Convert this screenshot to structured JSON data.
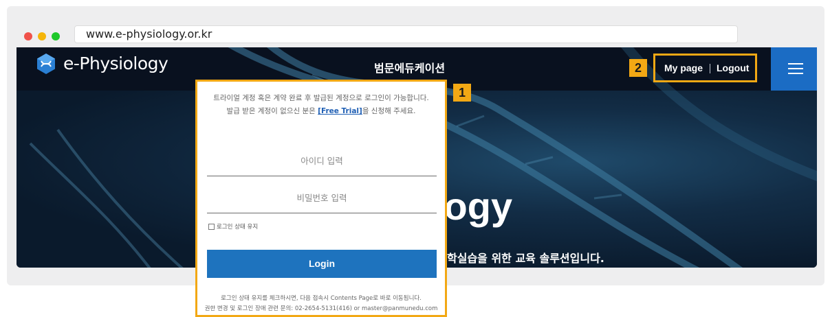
{
  "browser": {
    "url": "www.e-physiology.or.kr"
  },
  "header": {
    "logo_text": "e-Physiology",
    "title": "범문에듀케이션",
    "my_page": "My page",
    "logout": "Logout"
  },
  "hero": {
    "title": "logy",
    "subtitle": "학실습을 위한 교육 솔루션입니다."
  },
  "callouts": {
    "login_panel": "1",
    "account_links": "2"
  },
  "login": {
    "notice_line1": "트라이얼 계정 혹은 계약 완료 후 발급된 계정으로 로그인이 가능합니다.",
    "notice_line2_prefix": "발급 받은 계정이 없으신 분은 ",
    "free_trial_link": "[Free Trial]",
    "notice_line2_suffix": "을 신청해 주세요.",
    "id_placeholder": "아이디 입력",
    "password_placeholder": "비밀번호 입력",
    "remember_label": "로그인 상태 유지",
    "login_button": "Login",
    "footnote_line1": "로그인 상태 유지를 체크하시면, 다음 접속시 Contents Page로 바로 이동됩니다.",
    "footnote_line2": "권한 변경 및 로그인 장애 관련 문의: 02-2654-5131(416) or master@panmunedu.com"
  },
  "colors": {
    "accent": "#f2a814",
    "brand_blue": "#1e73be",
    "header_bg": "#09111f"
  },
  "icons": {
    "logo": "dna-hexagon-icon",
    "menu": "hamburger-menu-icon",
    "checkbox": "checkbox-icon"
  }
}
